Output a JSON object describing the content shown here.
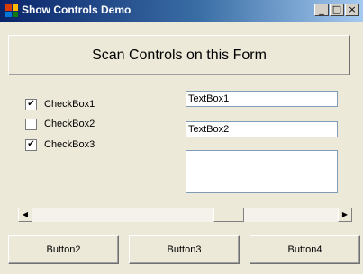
{
  "window": {
    "title": "Show Controls Demo",
    "minimize_glyph": "_",
    "maximize_glyph": "□",
    "close_glyph": "×"
  },
  "scan_button": {
    "label": "Scan Controls on this Form"
  },
  "checkboxes": [
    {
      "label": "CheckBox1",
      "checked": true,
      "mark": "✔"
    },
    {
      "label": "CheckBox2",
      "checked": false,
      "mark": ""
    },
    {
      "label": "CheckBox3",
      "checked": true,
      "mark": "✔"
    }
  ],
  "textboxes": [
    {
      "value": "TextBox1"
    },
    {
      "value": "TextBox2"
    }
  ],
  "multiline_textbox": {
    "value": ""
  },
  "scrollbar": {
    "left_arrow": "◀",
    "right_arrow": "▶",
    "position": 0.66
  },
  "buttons": [
    {
      "label": "Button2"
    },
    {
      "label": "Button3"
    },
    {
      "label": "Button4"
    }
  ],
  "colors": {
    "title_text": "#ffffff",
    "form_background": "#ece9d8",
    "app_icon": [
      "#d83b01",
      "#ffb900",
      "#0078d7",
      "#107c10"
    ]
  }
}
